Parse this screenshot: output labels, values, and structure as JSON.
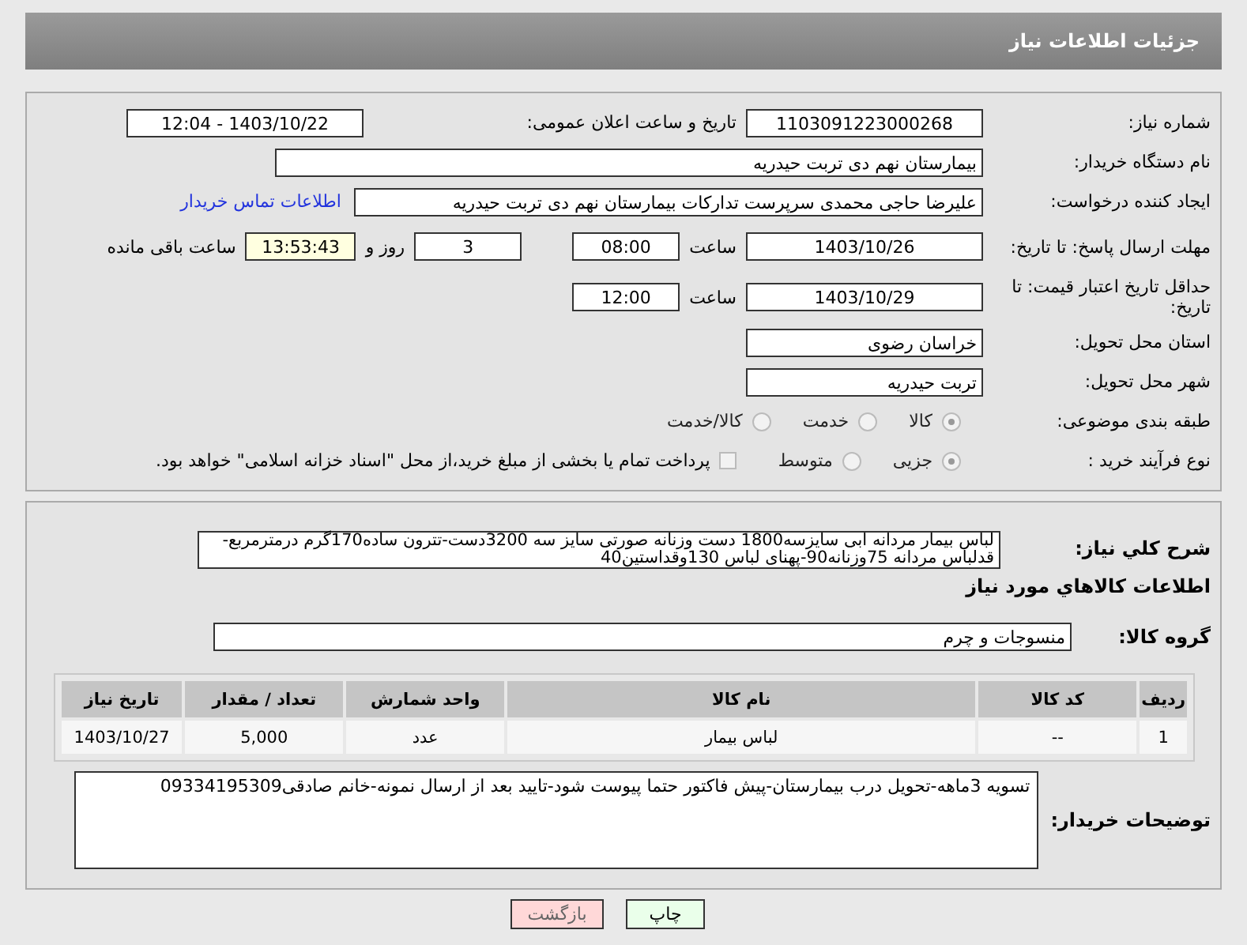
{
  "header": {
    "title": "جزئیات اطلاعات نیاز"
  },
  "details": {
    "need_number": {
      "label": "شماره نیاز:",
      "value": "1103091223000268"
    },
    "announce": {
      "label": "تاریخ و ساعت اعلان عمومی:",
      "value": "1403/10/22 - 12:04"
    },
    "buyer_org": {
      "label": "نام دستگاه خریدار:",
      "value": "بیمارستان نهم دی تربت حیدریه"
    },
    "requester": {
      "label": "ایجاد کننده درخواست:",
      "value": "علیرضا حاجی محمدی سرپرست تدارکات بیمارستان نهم دی تربت حیدریه",
      "link": "اطلاعات تماس خریدار"
    },
    "deadline": {
      "label": "مهلت ارسال پاسخ: تا تاریخ:",
      "date": "1403/10/26",
      "time_label": "ساعت",
      "time": "08:00",
      "days": "3",
      "days_label": "روز و",
      "remaining": "13:53:43",
      "remaining_label": "ساعت باقی مانده"
    },
    "validity": {
      "label": "حداقل تاریخ اعتبار قیمت: تا تاریخ:",
      "date": "1403/10/29",
      "time_label": "ساعت",
      "time": "12:00"
    },
    "province": {
      "label": "استان محل تحویل:",
      "value": "خراسان رضوی"
    },
    "city": {
      "label": "شهر محل تحویل:",
      "value": "تربت حیدریه"
    },
    "category": {
      "label": "طبقه بندی موضوعی:",
      "options": [
        {
          "label": "کالا",
          "selected": true
        },
        {
          "label": "خدمت",
          "selected": false
        },
        {
          "label": "کالا/خدمت",
          "selected": false
        }
      ]
    },
    "process": {
      "label": "نوع فرآیند خرید :",
      "options": [
        {
          "label": "جزیی",
          "selected": true
        },
        {
          "label": "متوسط",
          "selected": false
        }
      ],
      "treasury": {
        "label": "پرداخت تمام یا بخشی از مبلغ خرید،از محل \"اسناد خزانه اسلامی\" خواهد بود.",
        "checked": false
      }
    }
  },
  "needs": {
    "description": {
      "label": "شرح كلي نياز:",
      "value": "لباس بیمار مردانه ابی سایزسه1800 دست وزنانه صورتی سایز سه 3200دست-تترون ساده170گرم درمترمربع-قدلباس مردانه 75وزنانه90-پهنای لباس 130وقداستین40"
    },
    "goods_heading": "اطلاعات كالاهاي مورد نياز",
    "group": {
      "label": "گروه کالا:",
      "value": "منسوجات و چرم"
    },
    "table": {
      "columns": [
        "ردیف",
        "کد کالا",
        "نام کالا",
        "واحد شمارش",
        "تعداد / مقدار",
        "تاریخ نیاز"
      ],
      "rows": [
        [
          "1",
          "--",
          "لباس بیمار",
          "عدد",
          "5,000",
          "1403/10/27"
        ]
      ]
    },
    "buyer_notes": {
      "label": "توضیحات خریدار:",
      "value": "تسویه 3ماهه-تحویل درب بیمارستان-پیش فاکتور حتما پیوست شود-تایید بعد از ارسال نمونه-خانم صادقی09334195309"
    }
  },
  "buttons": [
    {
      "label": "چاپ",
      "kind": "print"
    },
    {
      "label": "بازگشت",
      "kind": "back"
    }
  ]
}
